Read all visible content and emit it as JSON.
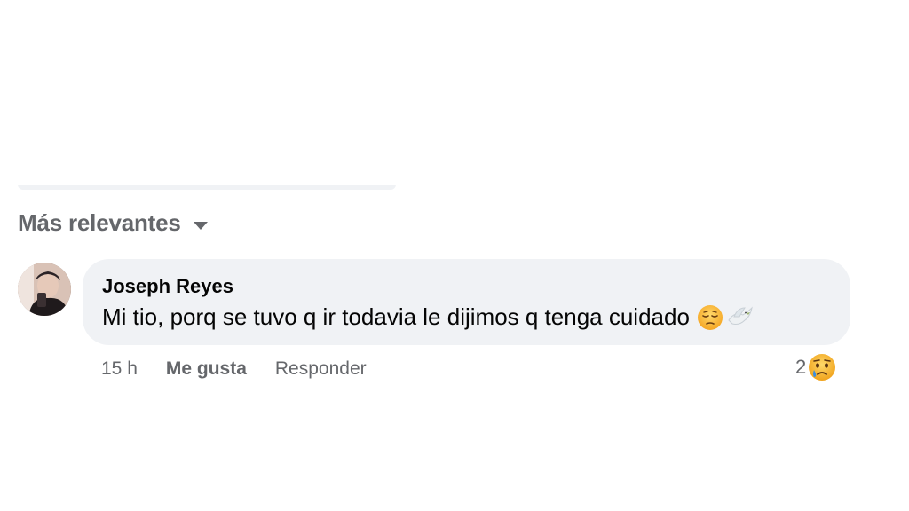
{
  "sort": {
    "label": "Más relevantes"
  },
  "comment": {
    "author": "Joseph Reyes",
    "text": "Mi tio, porq se tuvo q ir todavia le dijimos q tenga cuidado",
    "emojis": [
      "pensive-face-icon",
      "dove-icon"
    ],
    "time": "15 h",
    "like_label": "Me gusta",
    "reply_label": "Responder",
    "reaction_count": "2",
    "reaction_icon": "sad-face-icon"
  },
  "colors": {
    "bubble": "#f0f2f5",
    "secondary_text": "#65676b",
    "primary_text": "#050505"
  }
}
